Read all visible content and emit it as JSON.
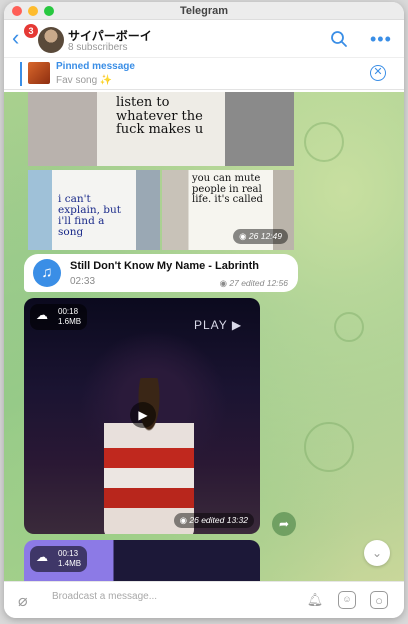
{
  "window": {
    "title": "Telegram"
  },
  "header": {
    "back_badge": "3",
    "channel_name": "サイパーボーイ",
    "subscribers": "8 subscribers"
  },
  "pinned": {
    "title": "Pinned message",
    "text": "Fav song ✨"
  },
  "photos": {
    "top_text": "listen to whatever the fuck makes u",
    "left_text": "i can't explain, but i'll find a song",
    "right_text": "you can mute people in real life. it's called",
    "right_meta": "26 12:49"
  },
  "music": {
    "title": "Still Don't Know My Name - Labrinth",
    "duration": "02:33",
    "meta": "27 edited 12:56"
  },
  "video1": {
    "duration": "00:18",
    "size": "1.6MB",
    "sign_text": "PLAY ▶",
    "meta": "26 edited 13:32"
  },
  "video2": {
    "duration": "00:13",
    "size": "1.4MB"
  },
  "composer": {
    "placeholder": "Broadcast a message..."
  },
  "colors": {
    "accent": "#3a8ee6",
    "badge": "#e53935",
    "chat_bg": "#a9d18e"
  }
}
